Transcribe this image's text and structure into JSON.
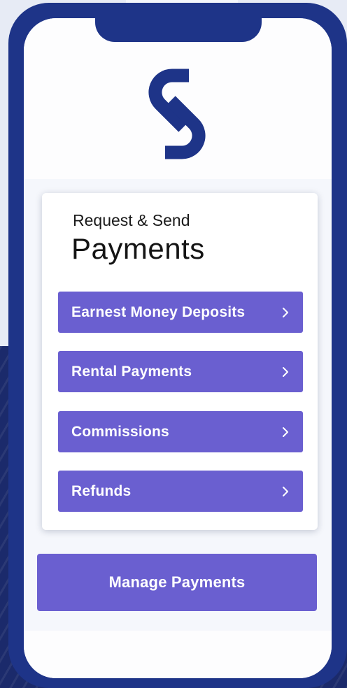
{
  "app": {
    "logo_icon": "s-link-logo-icon",
    "colors": {
      "frame": "#1e3488",
      "accent": "#6a5fd0",
      "logo": "#1e3488"
    }
  },
  "card": {
    "subtitle": "Request & Send",
    "title": "Payments",
    "items": [
      {
        "label": "Earnest Money Deposits",
        "icon": "chevron-right-icon"
      },
      {
        "label": "Rental Payments",
        "icon": "chevron-right-icon"
      },
      {
        "label": "Commissions",
        "icon": "chevron-right-icon"
      },
      {
        "label": "Refunds",
        "icon": "chevron-right-icon"
      }
    ]
  },
  "actions": {
    "manage_label": "Manage Payments"
  }
}
